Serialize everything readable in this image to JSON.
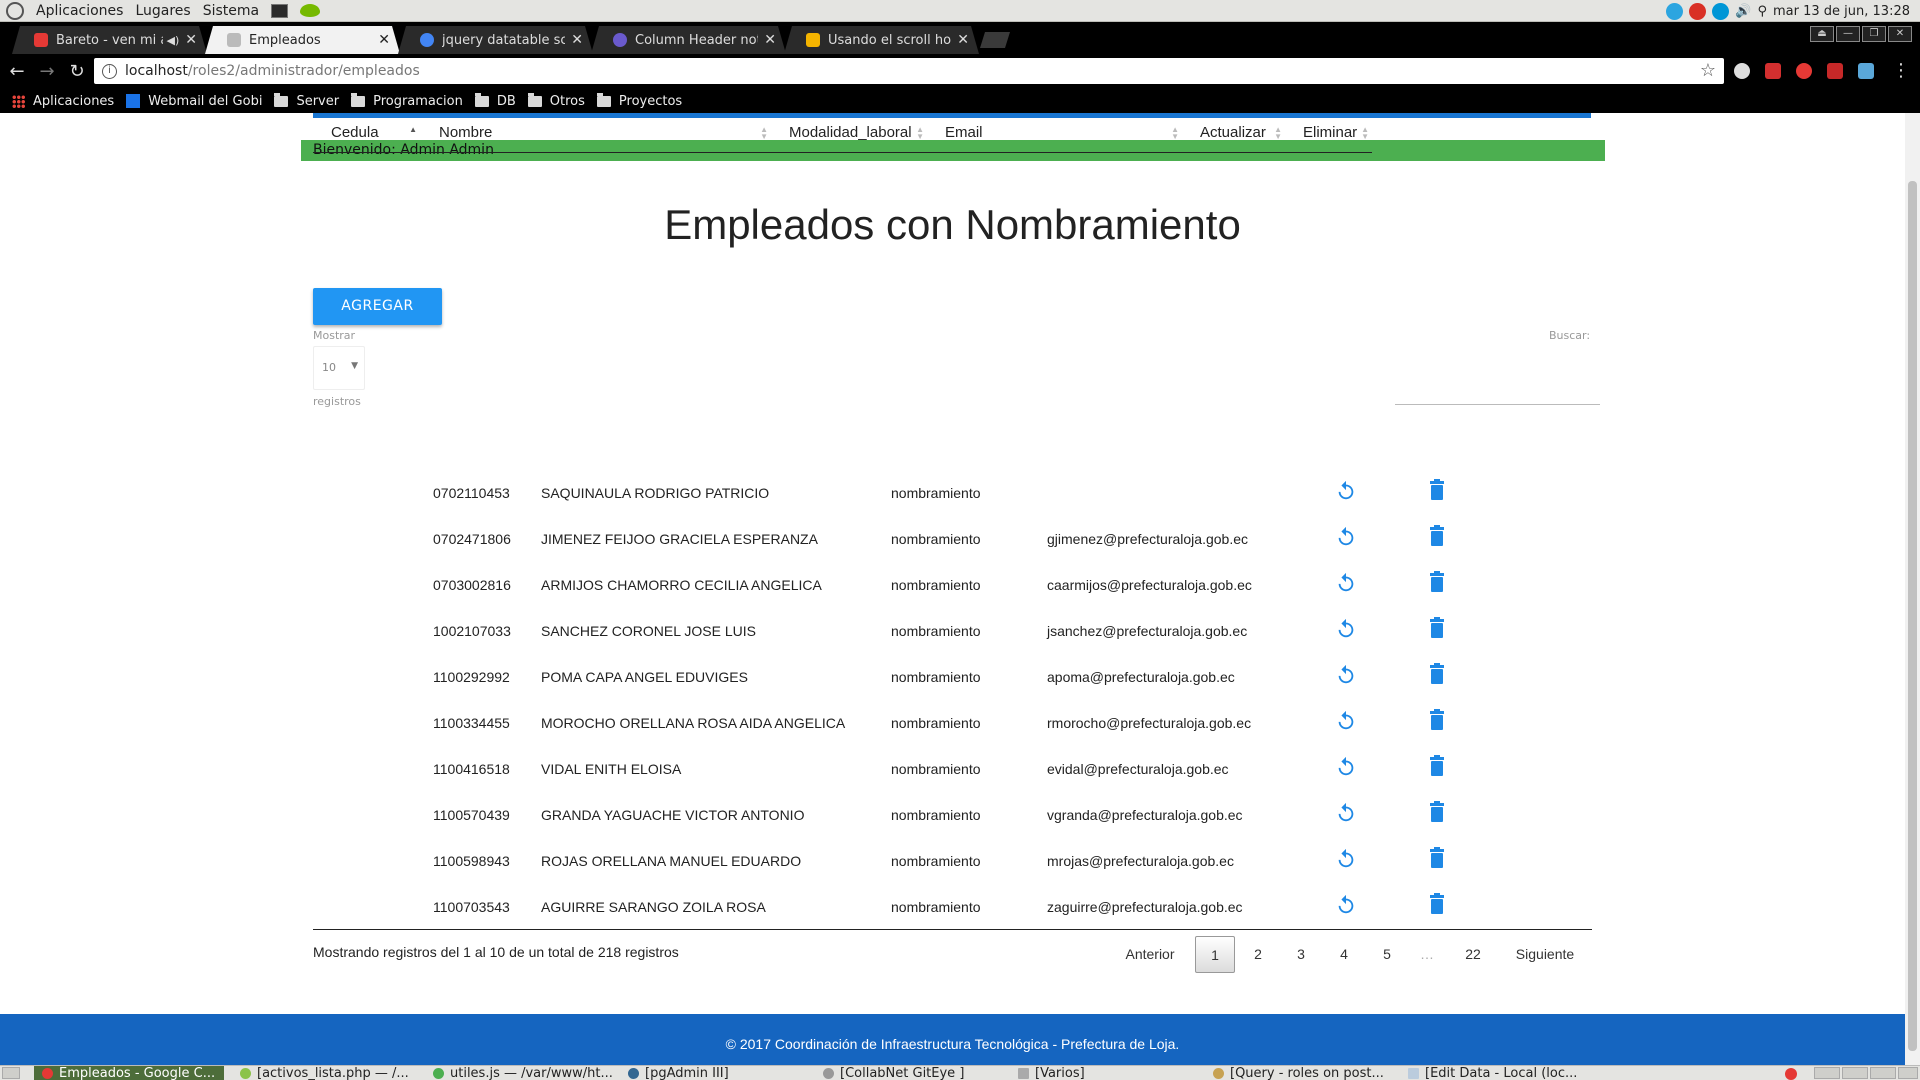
{
  "panel": {
    "menu": [
      "Aplicaciones",
      "Lugares",
      "Sistema"
    ],
    "clock": "mar 13 de jun, 13:28"
  },
  "tabs": [
    {
      "label": "Bareto - ven mi amor",
      "icon": "youtube-icon",
      "color": "#e53935"
    },
    {
      "label": "Empleados",
      "icon": "page-icon",
      "color": "#bbbbbb"
    },
    {
      "label": "jquery datatable scroll",
      "icon": "google-icon",
      "color": "#4285f4"
    },
    {
      "label": "Column Header not",
      "icon": "globe-icon",
      "color": "#6a5acd"
    },
    {
      "label": "Usando el scroll hori",
      "icon": "so-icon",
      "color": "#f4b400"
    }
  ],
  "url": {
    "host": "localhost",
    "path": "/roles2/administrador/empleados"
  },
  "bookmarks": [
    "Aplicaciones",
    "Webmail del Gobi",
    "Server",
    "Programacion",
    "DB",
    "Otros",
    "Proyectos"
  ],
  "page": {
    "welcome": "Bienvenido: Admin Admin",
    "title": "Empleados con Nombramiento",
    "add_button": "AGREGAR",
    "show_label": "Mostrar",
    "page_size": "10",
    "records_label": "registros",
    "search_label": "Buscar:",
    "columns": [
      "Cedula",
      "Nombre",
      "Modalidad_laboral",
      "Email",
      "Actualizar",
      "Eliminar"
    ],
    "rows": [
      {
        "cedula": "0702110453",
        "nombre": "SAQUINAULA RODRIGO PATRICIO",
        "modalidad": "nombramiento",
        "email": ""
      },
      {
        "cedula": "0702471806",
        "nombre": "JIMENEZ FEIJOO GRACIELA ESPERANZA",
        "modalidad": "nombramiento",
        "email": "gjimenez@prefecturaloja.gob.ec"
      },
      {
        "cedula": "0703002816",
        "nombre": "ARMIJOS CHAMORRO CECILIA ANGELICA",
        "modalidad": "nombramiento",
        "email": "caarmijos@prefecturaloja.gob.ec"
      },
      {
        "cedula": "1002107033",
        "nombre": "SANCHEZ CORONEL JOSE LUIS",
        "modalidad": "nombramiento",
        "email": "jsanchez@prefecturaloja.gob.ec"
      },
      {
        "cedula": "1100292992",
        "nombre": "POMA CAPA ANGEL EDUVIGES",
        "modalidad": "nombramiento",
        "email": "apoma@prefecturaloja.gob.ec"
      },
      {
        "cedula": "1100334455",
        "nombre": "MOROCHO ORELLANA ROSA AIDA ANGELICA",
        "modalidad": "nombramiento",
        "email": "rmorocho@prefecturaloja.gob.ec"
      },
      {
        "cedula": "1100416518",
        "nombre": "VIDAL ENITH ELOISA",
        "modalidad": "nombramiento",
        "email": "evidal@prefecturaloja.gob.ec"
      },
      {
        "cedula": "1100570439",
        "nombre": "GRANDA YAGUACHE VICTOR ANTONIO",
        "modalidad": "nombramiento",
        "email": "vgranda@prefecturaloja.gob.ec"
      },
      {
        "cedula": "1100598943",
        "nombre": "ROJAS ORELLANA MANUEL EDUARDO",
        "modalidad": "nombramiento",
        "email": "mrojas@prefecturaloja.gob.ec"
      },
      {
        "cedula": "1100703543",
        "nombre": "AGUIRRE SARANGO ZOILA ROSA",
        "modalidad": "nombramiento",
        "email": "zaguirre@prefecturaloja.gob.ec"
      }
    ],
    "info": "Mostrando registros del 1 al 10 de un total de 218 registros",
    "pagination": {
      "prev": "Anterior",
      "pages": [
        "1",
        "2",
        "3",
        "4",
        "5",
        "…",
        "22"
      ],
      "next": "Siguiente",
      "current": "1"
    },
    "footer": "© 2017 Coordinación de Infraestructura Tecnológica - Prefectura de Loja."
  },
  "taskbar": [
    {
      "label": "Empleados - Google C...",
      "active": true
    },
    {
      "label": "[activos_lista.php — /...",
      "active": false
    },
    {
      "label": "utiles.js — /var/www/ht...",
      "active": false
    },
    {
      "label": "[pgAdmin III]",
      "active": false
    },
    {
      "label": "[CollabNet GitEye ]",
      "active": false
    },
    {
      "label": "[Varios]",
      "active": false
    },
    {
      "label": "[Query - roles on post...",
      "active": false
    },
    {
      "label": "[Edit Data - Local (loc...",
      "active": false
    }
  ],
  "colors": {
    "accent": "#2196f3",
    "welcome": "#4caf50",
    "footer": "#1565c0"
  }
}
